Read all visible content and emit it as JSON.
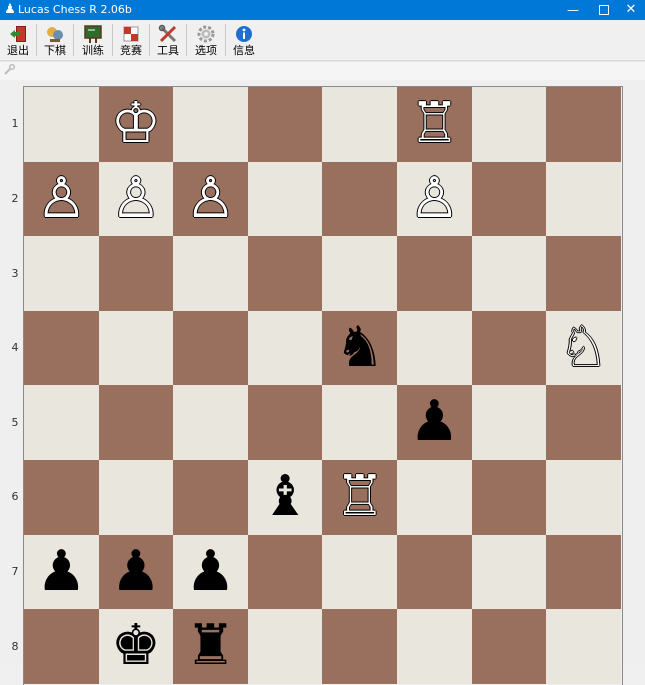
{
  "window": {
    "title": "Lucas Chess R 2.06b"
  },
  "window_controls": {
    "minimize": "—",
    "close": "✕"
  },
  "toolbar": {
    "items": [
      {
        "label": "退出",
        "icon": "exit-icon"
      },
      {
        "label": "下棋",
        "icon": "play-icon"
      },
      {
        "label": "训练",
        "icon": "training-icon"
      },
      {
        "label": "竞赛",
        "icon": "competition-icon"
      },
      {
        "label": "工具",
        "icon": "tools-icon"
      },
      {
        "label": "选项",
        "icon": "options-gear-icon"
      },
      {
        "label": "信息",
        "icon": "info-icon"
      }
    ]
  },
  "board": {
    "colors": {
      "light": "#e9e6de",
      "dark": "#996f5e"
    },
    "rank_labels": [
      "1",
      "2",
      "3",
      "4",
      "5",
      "6",
      "7",
      "8"
    ],
    "pieces": [
      {
        "rank": 1,
        "file": 2,
        "glyph": "♔",
        "color": "white",
        "name": "white-king"
      },
      {
        "rank": 1,
        "file": 6,
        "glyph": "♖",
        "color": "white",
        "name": "white-rook"
      },
      {
        "rank": 2,
        "file": 1,
        "glyph": "♙",
        "color": "white",
        "name": "white-pawn"
      },
      {
        "rank": 2,
        "file": 2,
        "glyph": "♙",
        "color": "white",
        "name": "white-pawn"
      },
      {
        "rank": 2,
        "file": 3,
        "glyph": "♙",
        "color": "white",
        "name": "white-pawn"
      },
      {
        "rank": 2,
        "file": 6,
        "glyph": "♙",
        "color": "white",
        "name": "white-pawn"
      },
      {
        "rank": 4,
        "file": 5,
        "glyph": "♞",
        "color": "black",
        "name": "black-knight"
      },
      {
        "rank": 4,
        "file": 8,
        "glyph": "♘",
        "color": "white",
        "name": "white-knight"
      },
      {
        "rank": 5,
        "file": 6,
        "glyph": "♟",
        "color": "black",
        "name": "black-pawn"
      },
      {
        "rank": 6,
        "file": 4,
        "glyph": "♝",
        "color": "black",
        "name": "black-bishop"
      },
      {
        "rank": 6,
        "file": 5,
        "glyph": "♖",
        "color": "white",
        "name": "white-rook"
      },
      {
        "rank": 7,
        "file": 1,
        "glyph": "♟",
        "color": "black",
        "name": "black-pawn"
      },
      {
        "rank": 7,
        "file": 2,
        "glyph": "♟",
        "color": "black",
        "name": "black-pawn"
      },
      {
        "rank": 7,
        "file": 3,
        "glyph": "♟",
        "color": "black",
        "name": "black-pawn"
      },
      {
        "rank": 8,
        "file": 2,
        "glyph": "♚",
        "color": "black",
        "name": "black-king"
      },
      {
        "rank": 8,
        "file": 3,
        "glyph": "♜",
        "color": "black",
        "name": "black-rook"
      }
    ]
  }
}
